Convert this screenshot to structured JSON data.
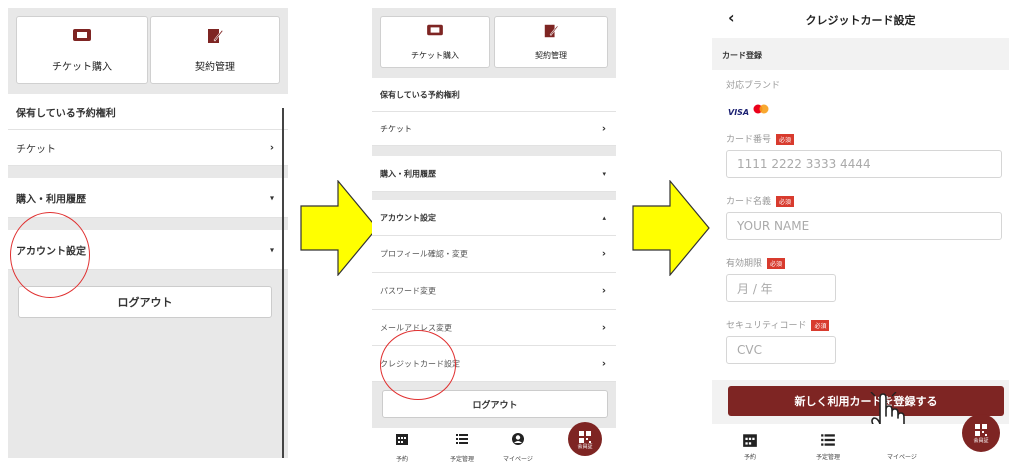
{
  "panel1": {
    "buttons": [
      {
        "label": "チケット購入",
        "icon": "ticket-icon"
      },
      {
        "label": "契約管理",
        "icon": "contract-edit-icon"
      }
    ],
    "section_title": "保有している予約権利",
    "rows": [
      {
        "label": "チケット",
        "chevron": "›"
      },
      {
        "label": "購入・利用履歴",
        "chevron": "▾"
      },
      {
        "label": "アカウント設定",
        "chevron": "▾"
      }
    ],
    "logout": "ログアウト"
  },
  "panel2": {
    "buttons": [
      {
        "label": "チケット購入",
        "icon": "ticket-icon"
      },
      {
        "label": "契約管理",
        "icon": "contract-edit-icon"
      }
    ],
    "section_title": "保有している予約権利",
    "rows": [
      {
        "label": "チケット",
        "chevron": "›"
      },
      {
        "label": "購入・利用履歴",
        "chevron": "▾"
      },
      {
        "label": "アカウント設定",
        "chevron": "▴"
      },
      {
        "label": "プロフィール確認・変更",
        "chevron": "›"
      },
      {
        "label": "パスワード変更",
        "chevron": "›"
      },
      {
        "label": "メールアドレス変更",
        "chevron": "›"
      },
      {
        "label": "クレジットカード設定",
        "chevron": "›"
      }
    ],
    "logout": "ログアウト",
    "nav": [
      {
        "label": "予約",
        "icon": "calendar-icon"
      },
      {
        "label": "予定管理",
        "icon": "list-icon"
      },
      {
        "label": "マイページ",
        "icon": "user-icon"
      },
      {
        "label": "会員証",
        "icon": "qr-code-icon"
      }
    ]
  },
  "panel3": {
    "back": "‹",
    "title": "クレジットカード設定",
    "section": "カード登録",
    "brands_label": "対応ブランド",
    "brands": [
      "VISA",
      "mastercard"
    ],
    "required_badge": "必須",
    "fields": [
      {
        "label": "カード番号",
        "placeholder": "1111 2222 3333 4444"
      },
      {
        "label": "カード名義",
        "placeholder": "YOUR NAME"
      },
      {
        "label": "有効期限",
        "placeholder": "月 / 年"
      },
      {
        "label": "セキュリティコード",
        "placeholder": "CVC"
      }
    ],
    "submit": "新しく利用カードを登録する",
    "nav": [
      {
        "label": "予約",
        "icon": "calendar-icon"
      },
      {
        "label": "予定管理",
        "icon": "list-icon"
      },
      {
        "label": "マイページ",
        "icon": "user-icon"
      },
      {
        "label": "会員証",
        "icon": "qr-code-icon"
      }
    ]
  },
  "colors": {
    "accent": "#7e2523",
    "arrow": "#ffff00",
    "circle": "#e03030",
    "required": "#d83b2e"
  }
}
